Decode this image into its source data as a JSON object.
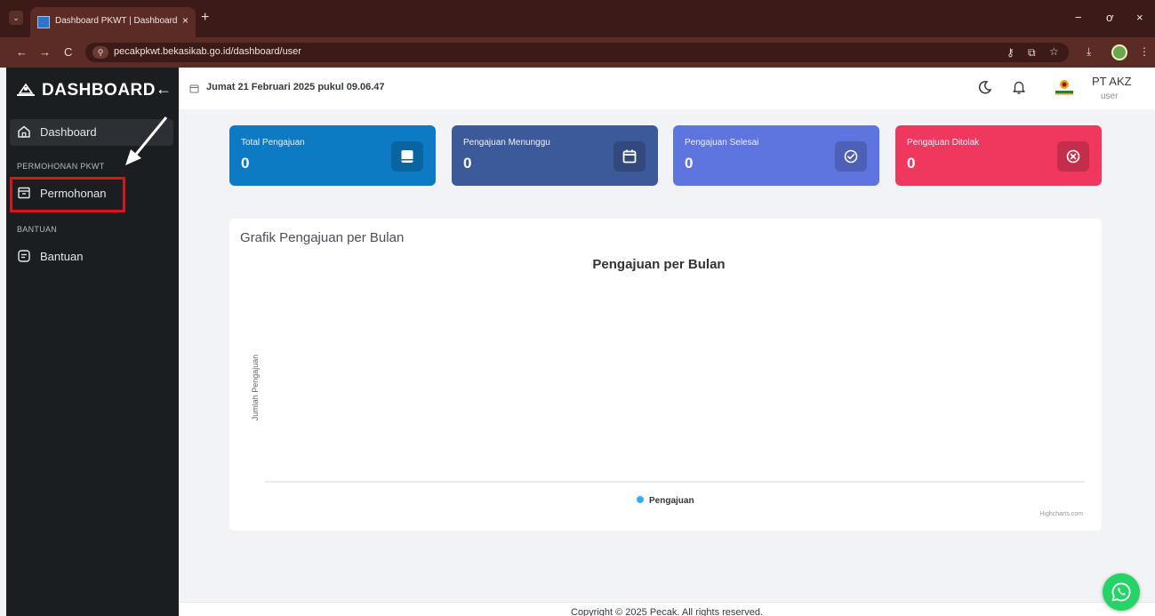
{
  "browser": {
    "tab_title": "Dashboard PKWT | Dashboard",
    "tab_close": "×",
    "new_tab": "+",
    "url": "pecakpkwt.bekasikab.go.id/dashboard/user",
    "back": "←",
    "forward": "→",
    "reload": "C",
    "minimize": "−",
    "restore": "ơ",
    "close": "×"
  },
  "sidebar": {
    "brand": "DASHBOARD",
    "sections": [
      {
        "title": "PERMOHONAN PKWT"
      },
      {
        "title": "BANTUAN"
      }
    ],
    "items": [
      {
        "label": "Dashboard",
        "icon": "home-icon",
        "active": true
      },
      {
        "label": "Permohonan",
        "icon": "archive-icon",
        "active": false
      },
      {
        "label": "Bantuan",
        "icon": "message-square-icon",
        "active": false
      }
    ]
  },
  "header": {
    "datetime": "Jumat 21 Februari 2025 pukul 09.06.47",
    "company": "PT AKZ",
    "role": "user"
  },
  "stats": [
    {
      "label": "Total Pengajuan",
      "value": "0",
      "color": "#0d7bc4",
      "icon": "book-icon"
    },
    {
      "label": "Pengajuan Menunggu",
      "value": "0",
      "color": "#3c5a99",
      "icon": "calendar-icon"
    },
    {
      "label": "Pengajuan Selesai",
      "value": "0",
      "color": "#5e74df",
      "icon": "check-circle-icon"
    },
    {
      "label": "Pengajuan Ditolak",
      "value": "0",
      "color": "#f0375d",
      "icon": "x-circle-icon"
    }
  ],
  "chart_card": {
    "title": "Grafik Pengajuan per Bulan"
  },
  "chart_data": {
    "type": "bar",
    "title": "Pengajuan per Bulan",
    "ylabel": "Jumlah Pengajuan",
    "categories": [],
    "series": [
      {
        "name": "Pengajuan",
        "values": [],
        "color": "#2caffe"
      }
    ],
    "legend": "bottom-center",
    "credits": "Highcharts.com"
  },
  "footer": {
    "text": "Copyright © 2025 Pecak. All rights reserved."
  }
}
